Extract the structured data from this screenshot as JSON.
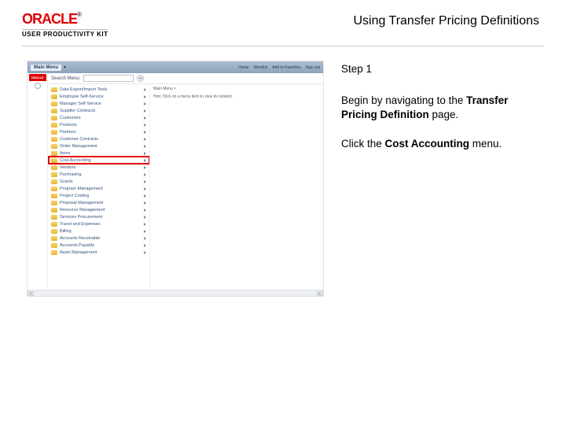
{
  "header": {
    "brand_main": "ORACLE",
    "brand_reg": "®",
    "brand_sub": "USER PRODUCTIVITY KIT",
    "lesson_title": "Using Transfer Pricing Definitions"
  },
  "instructions": {
    "step_label": "Step 1",
    "body_pre": "Begin by navigating to the ",
    "body_bold": "Transfer Pricing Definition",
    "body_post": " page.",
    "action_pre": "Click the ",
    "action_bold": "Cost Accounting",
    "action_post": " menu."
  },
  "screenshot": {
    "side_badge": "ORACLE",
    "topbar": {
      "main_menu": "Main Menu",
      "links": [
        "Home",
        "Worklist",
        "Add to Favorites",
        "Sign out"
      ]
    },
    "search": {
      "label": "Search Menu:",
      "placeholder": "",
      "go": "≫"
    },
    "breadcrumb": "Main Menu >",
    "detail_hint": "Hint: Click on a menu item to view its content.",
    "menu_items": [
      "Data Export/Import Tools",
      "Employee Self-Service",
      "Manager Self-Service",
      "Supplier Contracts",
      "Customers",
      "Products",
      "Partners",
      "Customer Contracts",
      "Order Management",
      "Items",
      "Cost Accounting",
      "Vendors",
      "Purchasing",
      "Grants",
      "Program Management",
      "Project Costing",
      "Proposal Management",
      "Resource Management",
      "Services Procurement",
      "Travel and Expenses",
      "Billing",
      "Accounts Receivable",
      "Accounts Payable",
      "Asset Management"
    ],
    "highlight_label": "Cost Accounting",
    "highlight_index": 10
  }
}
